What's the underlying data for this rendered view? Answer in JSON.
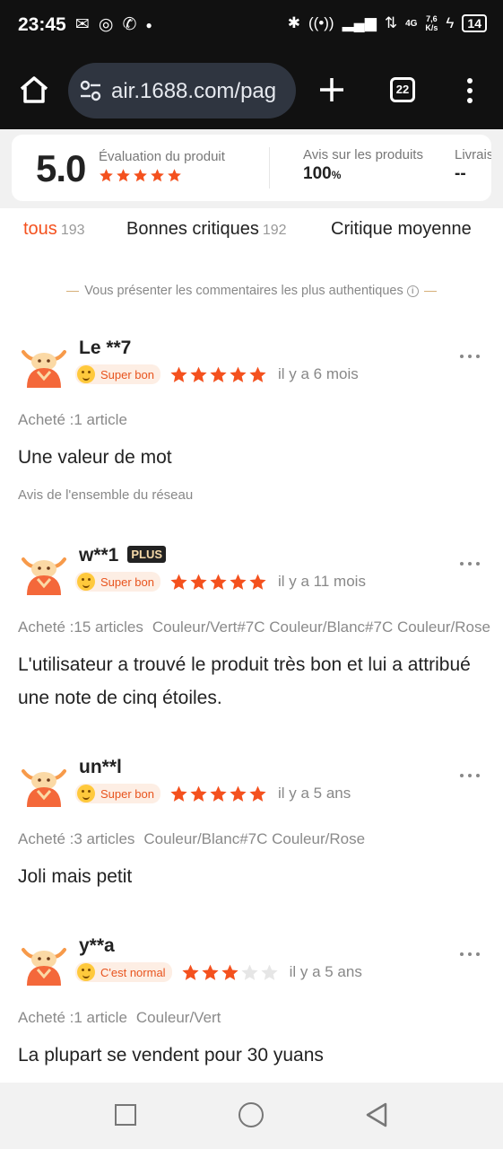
{
  "status_bar": {
    "time": "23:45",
    "network_speed_value": "7,6",
    "network_speed_unit": "K/s",
    "battery": "14",
    "network_type": "4G"
  },
  "browser": {
    "url": "air.1688.com/pag",
    "tab_count": "22"
  },
  "summary": {
    "score": "5.0",
    "score_label": "Évaluation du produit",
    "score_stars": 5,
    "reviews_label": "Avis sur les produits",
    "reviews_value": "100",
    "reviews_unit": "%",
    "delivery_label": "Livraiso",
    "delivery_value": "--"
  },
  "tabs": [
    {
      "label": "tous",
      "count": "193"
    },
    {
      "label": "Bonnes critiques",
      "count": "192"
    },
    {
      "label": "Critique moyenne",
      "count": ""
    }
  ],
  "notice": "Vous présenter les commentaires les plus authentiques",
  "reviews": [
    {
      "user": "Le **7",
      "plus": "",
      "badge": "Super bon",
      "stars": 5,
      "time": "il y a 6 mois",
      "purchased": "Acheté :1 article",
      "variant": "",
      "content": "Une valeur de mot",
      "source": "Avis de l'ensemble du réseau"
    },
    {
      "user": "w**1",
      "plus": "PLUS",
      "badge": "Super bon",
      "stars": 5,
      "time": "il y a 11 mois",
      "purchased": "Acheté :15 articles",
      "variant": "Couleur/Vert#7C Couleur/Blanc#7C Couleur/Rose",
      "content": "L'utilisateur a trouvé le produit très bon et lui a attribué une note de cinq étoiles.",
      "source": ""
    },
    {
      "user": "un**l",
      "plus": "",
      "badge": "Super bon",
      "stars": 5,
      "time": "il y a 5 ans",
      "purchased": "Acheté :3 articles",
      "variant": "Couleur/Blanc#7C Couleur/Rose",
      "content": "Joli mais petit",
      "source": ""
    },
    {
      "user": "y**a",
      "plus": "",
      "badge": "C'est normal",
      "stars": 3,
      "time": "il y a 5 ans",
      "purchased": "Acheté :1 article",
      "variant": "Couleur/Vert",
      "content": "La plupart se vendent pour 30 yuans",
      "source": ""
    }
  ],
  "colors": {
    "accent": "#f4511e",
    "star_on": "#f4511e",
    "star_off": "#e6e6e6"
  }
}
